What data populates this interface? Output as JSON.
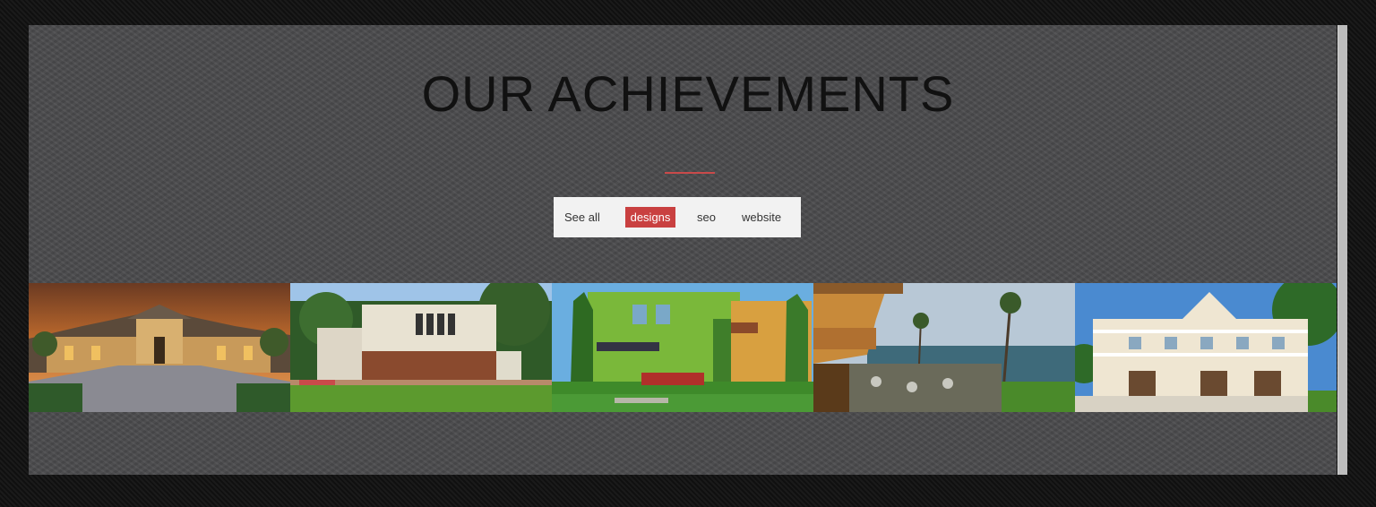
{
  "section": {
    "title": "OUR ACHIEVEMENTS",
    "accent_color": "#c94a4a"
  },
  "filters": [
    {
      "label": "See all",
      "active": false
    },
    {
      "label": "designs",
      "active": true
    },
    {
      "label": "seo",
      "active": false
    },
    {
      "label": "website",
      "active": false
    }
  ],
  "gallery": [
    {
      "icon": "mansion-sunset-image"
    },
    {
      "icon": "modern-house-image"
    },
    {
      "icon": "ivy-villa-image"
    },
    {
      "icon": "coastal-terrace-image"
    },
    {
      "icon": "white-villa-image"
    }
  ]
}
